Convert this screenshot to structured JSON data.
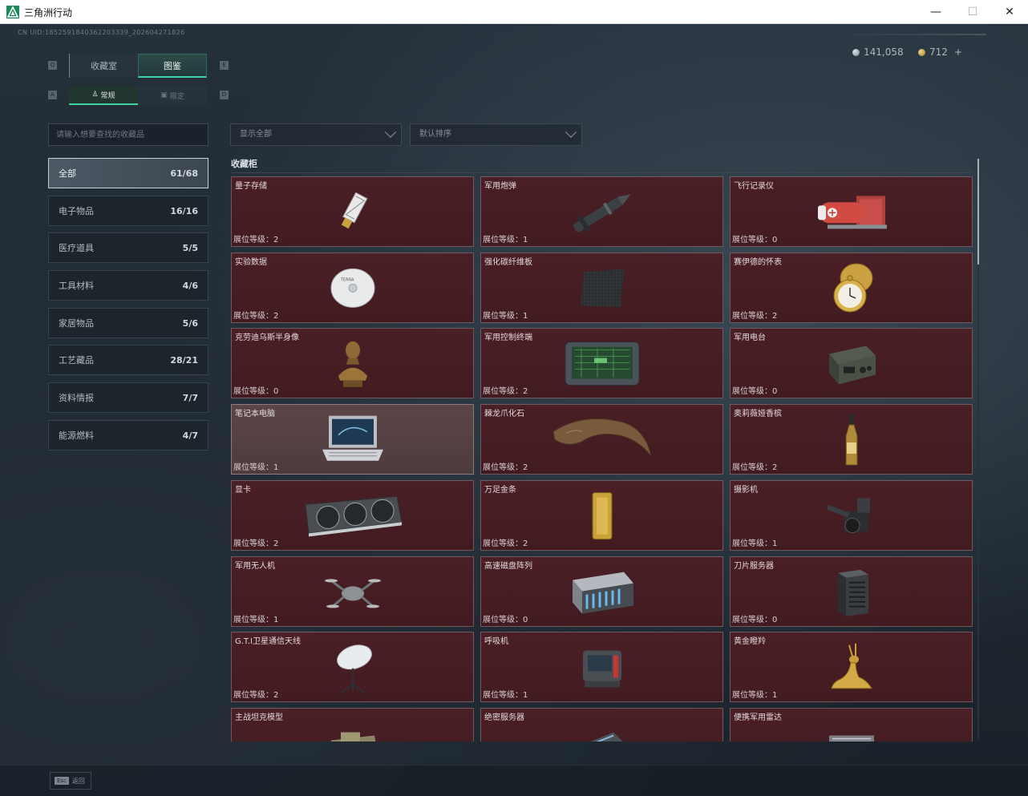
{
  "window": {
    "title": "三角洲行动",
    "minimize_glyph": "—",
    "maximize_glyph": "☐",
    "close_glyph": "✕"
  },
  "header": {
    "uid": "CN UID:1852591840362203339_202604271826",
    "currency_silver": "141,058",
    "currency_gold": "712",
    "currency_add": "+"
  },
  "key_hints": {
    "tab_left": "Q",
    "tab_right": "E",
    "subtab_left": "A",
    "subtab_right": "D"
  },
  "tabs": [
    {
      "label": "收藏室",
      "active": false
    },
    {
      "label": "图鉴",
      "active": true
    }
  ],
  "subtabs": [
    {
      "label": "常规",
      "icon": "figure-icon",
      "active": true
    },
    {
      "label": "限定",
      "icon": "box-icon",
      "active": false
    }
  ],
  "search": {
    "placeholder": "请输入想要查找的收藏品"
  },
  "categories": [
    {
      "label": "全部",
      "count": "61/68",
      "active": true
    },
    {
      "label": "电子物品",
      "count": "16/16"
    },
    {
      "label": "医疗道具",
      "count": "5/5"
    },
    {
      "label": "工具材料",
      "count": "4/6"
    },
    {
      "label": "家居物品",
      "count": "5/6"
    },
    {
      "label": "工艺藏品",
      "count": "28/21"
    },
    {
      "label": "资料情报",
      "count": "7/7"
    },
    {
      "label": "能源燃料",
      "count": "4/7"
    }
  ],
  "filters": {
    "display": "显示全部",
    "sort": "默认排序"
  },
  "section": {
    "title": "收藏柜"
  },
  "level_prefix": "展位等级：",
  "items": [
    {
      "name": "量子存储",
      "level": "2",
      "icon": "usb-drive-icon"
    },
    {
      "name": "军用炮弹",
      "level": "1",
      "icon": "artillery-shell-icon"
    },
    {
      "name": "飞行记录仪",
      "level": "0",
      "icon": "flight-recorder-icon"
    },
    {
      "name": "实验数据",
      "level": "2",
      "icon": "disc-icon"
    },
    {
      "name": "强化碳纤维板",
      "level": "1",
      "icon": "carbon-plate-icon"
    },
    {
      "name": "赛伊德的怀表",
      "level": "2",
      "icon": "pocket-watch-icon"
    },
    {
      "name": "克劳迪乌斯半身像",
      "level": "0",
      "icon": "bust-icon"
    },
    {
      "name": "军用控制终端",
      "level": "2",
      "icon": "control-terminal-icon"
    },
    {
      "name": "军用电台",
      "level": "0",
      "icon": "radio-icon"
    },
    {
      "name": "笔记本电脑",
      "level": "1",
      "icon": "laptop-icon",
      "selected": true
    },
    {
      "name": "棘龙爪化石",
      "level": "2",
      "icon": "claw-fossil-icon"
    },
    {
      "name": "奥莉薇娅香槟",
      "level": "2",
      "icon": "champagne-icon"
    },
    {
      "name": "显卡",
      "level": "2",
      "icon": "graphics-card-icon"
    },
    {
      "name": "万足金条",
      "level": "2",
      "icon": "gold-bar-icon"
    },
    {
      "name": "摄影机",
      "level": "1",
      "icon": "camera-icon"
    },
    {
      "name": "军用无人机",
      "level": "1",
      "icon": "drone-icon"
    },
    {
      "name": "高速磁盘阵列",
      "level": "0",
      "icon": "disk-array-icon"
    },
    {
      "name": "刀片服务器",
      "level": "0",
      "icon": "blade-server-icon"
    },
    {
      "name": "G.T.I卫星通信天线",
      "level": "2",
      "icon": "satellite-dish-icon"
    },
    {
      "name": "呼吸机",
      "level": "1",
      "icon": "ventilator-icon"
    },
    {
      "name": "黄金瞪羚",
      "level": "1",
      "icon": "golden-gazelle-icon"
    },
    {
      "name": "主战坦克模型",
      "level": "",
      "icon": "tank-model-icon"
    },
    {
      "name": "绝密服务器",
      "level": "",
      "icon": "server-icon"
    },
    {
      "name": "便携军用雷达",
      "level": "",
      "icon": "radar-icon"
    }
  ],
  "footer": {
    "esc_key": "Esc",
    "esc_label": "返回"
  }
}
